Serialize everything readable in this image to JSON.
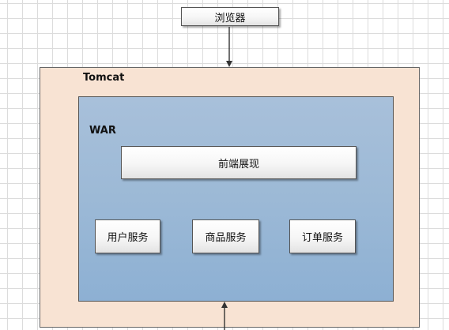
{
  "browser": {
    "label": "浏览器"
  },
  "tomcat": {
    "label": "Tomcat"
  },
  "war": {
    "label": "WAR",
    "frontend": {
      "label": "前端展现"
    },
    "services": [
      {
        "label": "用户服务"
      },
      {
        "label": "商品服务"
      },
      {
        "label": "订单服务"
      }
    ]
  },
  "colors": {
    "tomcat_fill": "#f8e3d3",
    "war_fill": "#9cb9d6",
    "box_fill": "#f6f6f6",
    "arrow": "#333333"
  }
}
